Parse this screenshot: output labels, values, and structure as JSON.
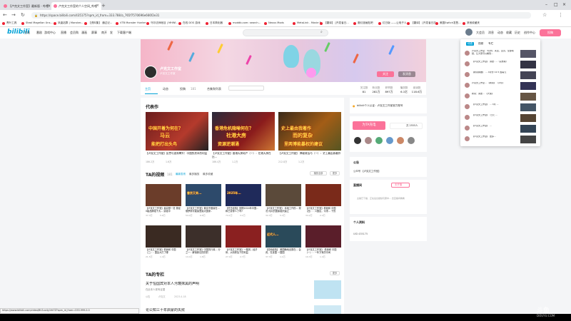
{
  "browser": {
    "tabs": [
      {
        "title": "【卢克文工作室】最新版 - 哔哩哔哩"
      },
      {
        "title": "卢克文工作室的个人空间_哔哩"
      }
    ],
    "url": "https://space.bilibili.com/435175?spm_id_from=333.788.b_765f7570696e666f2e31",
    "bookmarks": [
      "青叶工具",
      "Steal Magellan Uns...",
      "凤凰站群 | Monster...",
      "【资料集】 通过记...",
      "VTB Monster Hunter",
      "乌尔法师帐目 | MHWI..",
      "在线 DOS 游戏",
      "日本简化器",
      "moddb.com: search...",
      "Nexus Mods",
      "MetaLink - Movie F...",
      "【翻译】 [开发者日...",
      "魔幻漫画贴吧",
      "红日版 ——让电子人...",
      "【翻译】 [开发者日志...",
      "美国Switch发售...",
      "其他收藏夹"
    ],
    "status_url": "https://www.bilibili.com/video/BV1xx4y1fd7Z?spm_id_from=333.999.0.0"
  },
  "header": {
    "logo": "bilibili",
    "nav": [
      "主站",
      "番剧",
      "游戏中心",
      "直播",
      "会员购",
      "漫画",
      "赛事",
      "南开",
      "发",
      "下载客户端"
    ],
    "search_placeholder": "",
    "right": [
      "大会员",
      "消息",
      "动态",
      "收藏",
      "历史",
      "创作中心"
    ],
    "upload": "投稿"
  },
  "profile": {
    "name": "卢克文工作室",
    "sign": "卢克文工作室",
    "follow": "关注",
    "message": "发消息",
    "tabs": [
      "主页",
      "动态",
      "投稿",
      "合集和列表"
    ],
    "tab_counts": [
      "",
      "",
      "181",
      ""
    ],
    "stats": [
      {
        "label": "关注数",
        "value": "81"
      },
      {
        "label": "粉丝数",
        "value": "282万"
      },
      {
        "label": "获赞数",
        "value": "897万"
      },
      {
        "label": "播放数",
        "value": "6.1亿"
      },
      {
        "label": "阅读数",
        "value": "118.6万"
      }
    ]
  },
  "representative": {
    "title": "代表作",
    "items": [
      {
        "caption": "中国开着为何在？",
        "caption2": "马云",
        "caption3": "能把打出头鸟",
        "title": "【卢克文工作室】反思与逐渐攀升！中国的资本的利益",
        "views": "186.2万",
        "dm": "1.6万"
      },
      {
        "caption": "香港危机隐喻何在？",
        "caption2": "社港大房",
        "caption3": "资源逆潮涌",
        "title": "【卢克文工作室】香港大房地产（一）：在港大房在比...",
        "views": "186.4万",
        "dm": "1.2万"
      },
      {
        "caption": "史上最由我著作",
        "caption2": "而的复杂",
        "caption3": "里两博能暴权的建议",
        "title": "【卢克文工作室】 揭秘政治与（一）：史上最由我著作",
        "views": "212.8万",
        "dm": "1.2万"
      }
    ]
  },
  "videos": {
    "title": "TA的视频",
    "count": "181",
    "tabs": [
      "最新发布",
      "最多播放",
      "最多收藏"
    ],
    "play_all": "播放全部",
    "more": "更多",
    "items": [
      {
        "cap": "",
        "title": "【卢克文工作室】最高额一览 曾经0级品牌组下大... 讲组中",
        "views": "37.3万",
        "dm": "5.6万"
      },
      {
        "cap": "普京又来...",
        "title": "【卢克文工作室】普京不做最在... 俄罗斯可能最里最大国家..",
        "views": "54.4万",
        "dm": "6.8万"
      },
      {
        "cap": "2025年...",
        "title": "【驻日经验】回顾2024年中国... 和已变得么了吗?",
        "views": "74.1万",
        "dm": "3.1万"
      },
      {
        "cap": "",
        "title": "【卢克文工作室】 本地工作的... 现况 伟大的国象组织建立",
        "views": "32.3万",
        "dm": "5.3万"
      },
      {
        "cap": "",
        "title": "【卢克文工作室】看我和 中国（四）：川国区，今重... 下的",
        "views": "34.2万",
        "dm": "2.4万"
      },
      {
        "cap": "",
        "title": "【卢克文工作室】看我和 中国（三）：国会大打了哪",
        "views": "21.5万",
        "dm": "1.4万"
      },
      {
        "cap": "",
        "title": "【卢克文工作室】中国的行政... 分之一：解读新议的的的",
        "views": "14.4万",
        "dm": "1.8万"
      },
      {
        "cap": "",
        "title": "【卢克文工作室】一路风...经济体，从而获及下的利益",
        "views": "27.4万",
        "dm": "2.7万"
      },
      {
        "cap": "近代人...",
        "title": "【驻地经验】 美国确地全数在... 会资，在该国 一国国",
        "views": "37.3万",
        "dm": "1.1万"
      },
      {
        "cap": "",
        "title": "【卢克文工作室】 看我和 中国（一）：一年又有的中间",
        "views": "19.3万",
        "dm": "1.4万"
      }
    ]
  },
  "articles": {
    "title": "TA的专栏",
    "more": "更多",
    "items": [
      {
        "title": "关于恒国宾对本人污蔑抹黑的声明",
        "sub": "在此本人现有证据",
        "meta": [
          "公告",
          "卢克文",
          "2023-4-18"
        ]
      },
      {
        "title": "论公知三十年启蒙的失败",
        "sub": "",
        "meta": []
      }
    ]
  },
  "right": {
    "certify": "bilibili个人认证：卢克文工作室官方账号",
    "charge": "为TA充电",
    "charge_count": "共 2555人",
    "notice_title": "公告",
    "notice_text": "公众号 【卢克文工作室】",
    "live_title": "直播间",
    "live_status": "未开播",
    "live_note": "主播已下播，正在后台继续玩耍中... 去直播间看看",
    "live_link": "去直播间看看",
    "info_title": "个人资料",
    "uid": "UID 435175"
  },
  "popup": {
    "tabs": [
      "动态",
      "视频",
      "专栏"
    ],
    "items": [
      {
        "title": "卢克文工作室：3月份，关注，主页，全部视频，让大家可以看到..."
      },
      {
        "title": "【卢克文工作室】 讲述: ...（完整版）"
      },
      {
        "title": "【新闻摘要】 ... 4月份 12.5 国美元"
      },
      {
        "title": "卢克文工作室... 【新闻】 【2月】"
      },
      {
        "title": "新闻：讲述... 【大使】"
      },
      {
        "title": "【卢克文工作室】 ... 4月 ..."
      },
      {
        "title": "【卢克文工作室】: 日元 ..."
      },
      {
        "title": "【卢克文工作室】 ..."
      },
      {
        "title": "【卢克文工作室】 更多..."
      }
    ]
  },
  "watermark": {
    "main": "斗鱼",
    "sub": "DOUYU.COM"
  },
  "colors": {
    "accent": "#00a1d6",
    "pink": "#fb7299"
  }
}
